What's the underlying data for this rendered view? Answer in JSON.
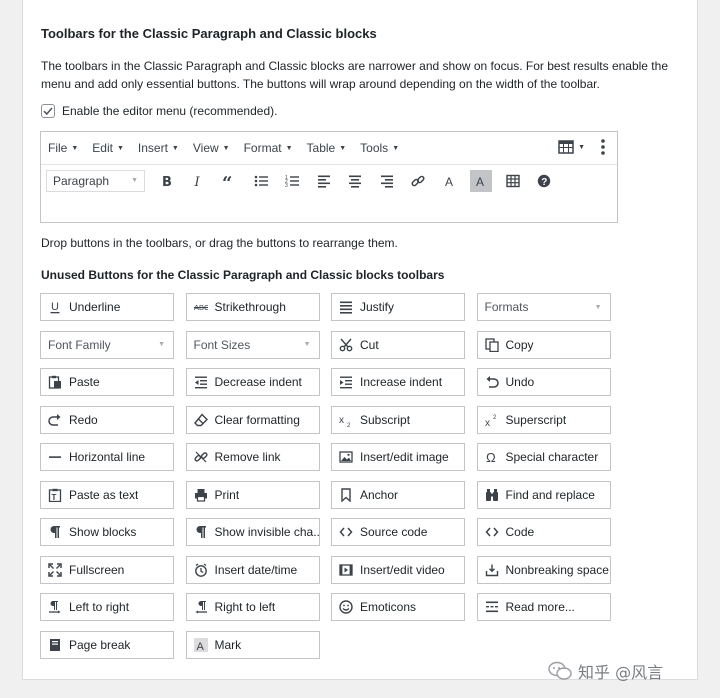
{
  "section": {
    "title": "Toolbars for the Classic Paragraph and Classic blocks",
    "description": "The toolbars in the Classic Paragraph and Classic blocks are narrower and show on focus. For best results enable the menu and add only essential buttons. The buttons will wrap around depending on the width of the toolbar.",
    "checkbox_label": "Enable the editor menu (recommended).",
    "checkbox_checked": true
  },
  "editor": {
    "menus": [
      "File",
      "Edit",
      "Insert",
      "View",
      "Format",
      "Table",
      "Tools"
    ],
    "paragraph_select": "Paragraph",
    "toolbar_icons": [
      "bold-icon",
      "italic-icon",
      "blockquote-icon",
      "bullet-list-icon",
      "numbered-list-icon",
      "align-left-icon",
      "align-center-icon",
      "align-right-icon",
      "link-icon",
      "text-color-icon",
      "background-color-icon",
      "table-icon",
      "help-icon"
    ]
  },
  "drop_hint": "Drop buttons in the toolbars, or drag the buttons to rearrange them.",
  "unused": {
    "title": "Unused Buttons for the Classic Paragraph and Classic blocks toolbars",
    "buttons": [
      {
        "label": "Underline",
        "icon": "underline-icon"
      },
      {
        "label": "Strikethrough",
        "icon": "strikethrough-icon"
      },
      {
        "label": "Justify",
        "icon": "justify-icon"
      },
      {
        "label": "Formats",
        "icon": "",
        "select": true
      },
      {
        "label": "Font Family",
        "icon": "",
        "select": true
      },
      {
        "label": "Font Sizes",
        "icon": "",
        "select": true
      },
      {
        "label": "Cut",
        "icon": "cut-icon"
      },
      {
        "label": "Copy",
        "icon": "copy-icon"
      },
      {
        "label": "Paste",
        "icon": "paste-icon"
      },
      {
        "label": "Decrease indent",
        "icon": "outdent-icon"
      },
      {
        "label": "Increase indent",
        "icon": "indent-icon"
      },
      {
        "label": "Undo",
        "icon": "undo-icon"
      },
      {
        "label": "Redo",
        "icon": "redo-icon"
      },
      {
        "label": "Clear formatting",
        "icon": "eraser-icon"
      },
      {
        "label": "Subscript",
        "icon": "subscript-icon"
      },
      {
        "label": "Superscript",
        "icon": "superscript-icon"
      },
      {
        "label": "Horizontal line",
        "icon": "horizontal-line-icon"
      },
      {
        "label": "Remove link",
        "icon": "unlink-icon"
      },
      {
        "label": "Insert/edit image",
        "icon": "image-icon"
      },
      {
        "label": "Special character",
        "icon": "omega-icon"
      },
      {
        "label": "Paste as text",
        "icon": "paste-text-icon"
      },
      {
        "label": "Print",
        "icon": "print-icon"
      },
      {
        "label": "Anchor",
        "icon": "bookmark-icon"
      },
      {
        "label": "Find and replace",
        "icon": "binoculars-icon"
      },
      {
        "label": "Show blocks",
        "icon": "pilcrow-icon"
      },
      {
        "label": "Show invisible cha...",
        "icon": "pilcrow-icon"
      },
      {
        "label": "Source code",
        "icon": "code-icon"
      },
      {
        "label": "Code",
        "icon": "code-icon"
      },
      {
        "label": "Fullscreen",
        "icon": "fullscreen-icon"
      },
      {
        "label": "Insert date/time",
        "icon": "clock-icon"
      },
      {
        "label": "Insert/edit video",
        "icon": "video-icon"
      },
      {
        "label": "Nonbreaking space",
        "icon": "nbsp-icon"
      },
      {
        "label": "Left to right",
        "icon": "ltr-icon"
      },
      {
        "label": "Right to left",
        "icon": "rtl-icon"
      },
      {
        "label": "Emoticons",
        "icon": "smiley-icon"
      },
      {
        "label": "Read more...",
        "icon": "read-more-icon"
      },
      {
        "label": "Page break",
        "icon": "page-break-icon"
      },
      {
        "label": "Mark",
        "icon": "mark-icon"
      }
    ]
  },
  "watermark": "知乎 @风言"
}
